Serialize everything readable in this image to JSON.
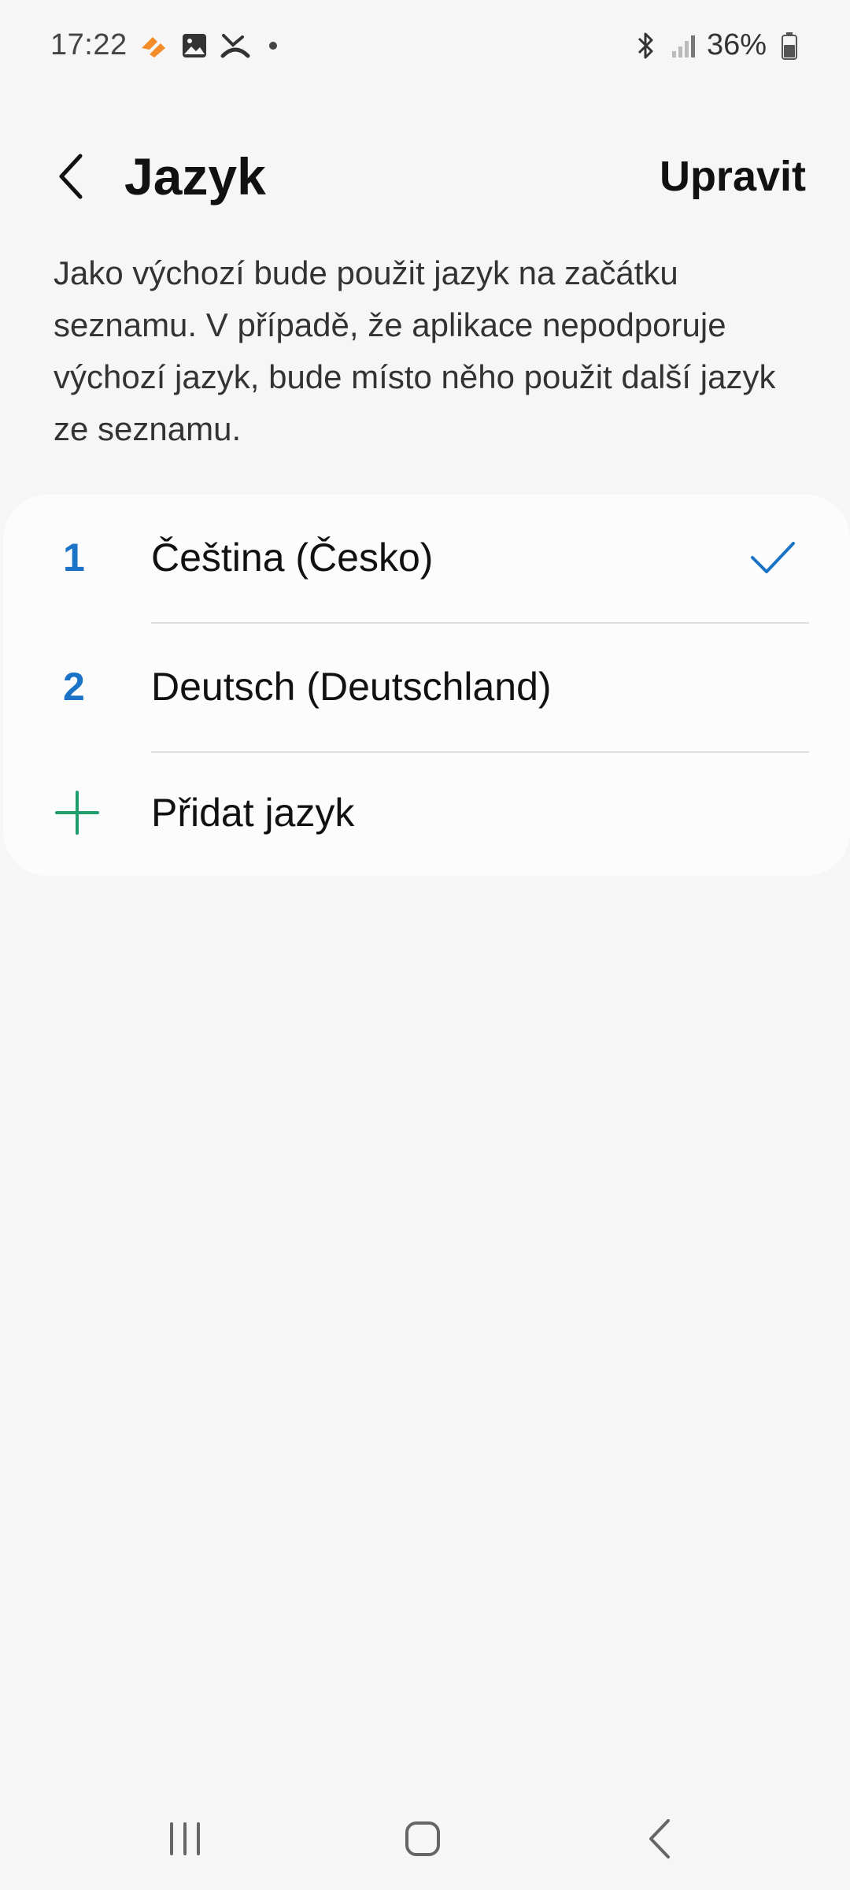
{
  "status_bar": {
    "time": "17:22",
    "notification_icons": [
      "streak-icon",
      "gallery-icon",
      "missed-call-icon"
    ],
    "battery_percent": "36%",
    "right_icons": [
      "bluetooth-icon",
      "signal-icon",
      "battery-icon"
    ]
  },
  "app_bar": {
    "title": "Jazyk",
    "edit_label": "Upravit"
  },
  "description": "Jako výchozí bude použit jazyk na začátku seznamu. V případě, že aplikace nepodporuje výchozí jazyk, bude místo něho použit další jazyk ze seznamu.",
  "languages": [
    {
      "index": "1",
      "label": "Čeština (Česko)",
      "selected": true
    },
    {
      "index": "2",
      "label": "Deutsch (Deutschland)",
      "selected": false
    }
  ],
  "add_language_label": "Přidat jazyk",
  "colors": {
    "accent_blue": "#1a73c7",
    "add_green": "#1f9d6b",
    "background": "#f6f6f6",
    "card": "#fcfcfc"
  },
  "nav_bar": {
    "buttons": [
      "recent-apps-icon",
      "home-icon",
      "back-icon"
    ]
  }
}
